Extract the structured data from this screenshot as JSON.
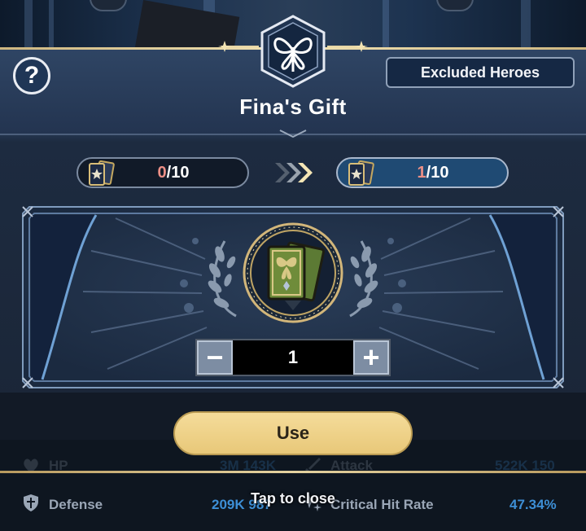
{
  "dialog": {
    "title": "Fina's Gift",
    "help_label": "?",
    "excluded_label": "Excluded Heroes"
  },
  "counters": {
    "left": {
      "current": "0",
      "max": "/10"
    },
    "right": {
      "current": "1",
      "max": "/10"
    }
  },
  "stepper": {
    "minus": "−",
    "value": "1",
    "plus": "+"
  },
  "use_label": "Use",
  "tap_close": "Tap to close",
  "stats": {
    "hp": {
      "label": "HP",
      "value": "3M 143K"
    },
    "attack": {
      "label": "Attack",
      "value": "522K 150"
    },
    "defense": {
      "label": "Defense",
      "value": "209K 987"
    },
    "crit": {
      "label": "Critical Hit Rate",
      "value": "47.34%"
    }
  },
  "colors": {
    "accent_gold": "#e8c879",
    "counter_current": "#ec8f86",
    "stat_value": "#3d8fd6",
    "panel": "#233450"
  }
}
